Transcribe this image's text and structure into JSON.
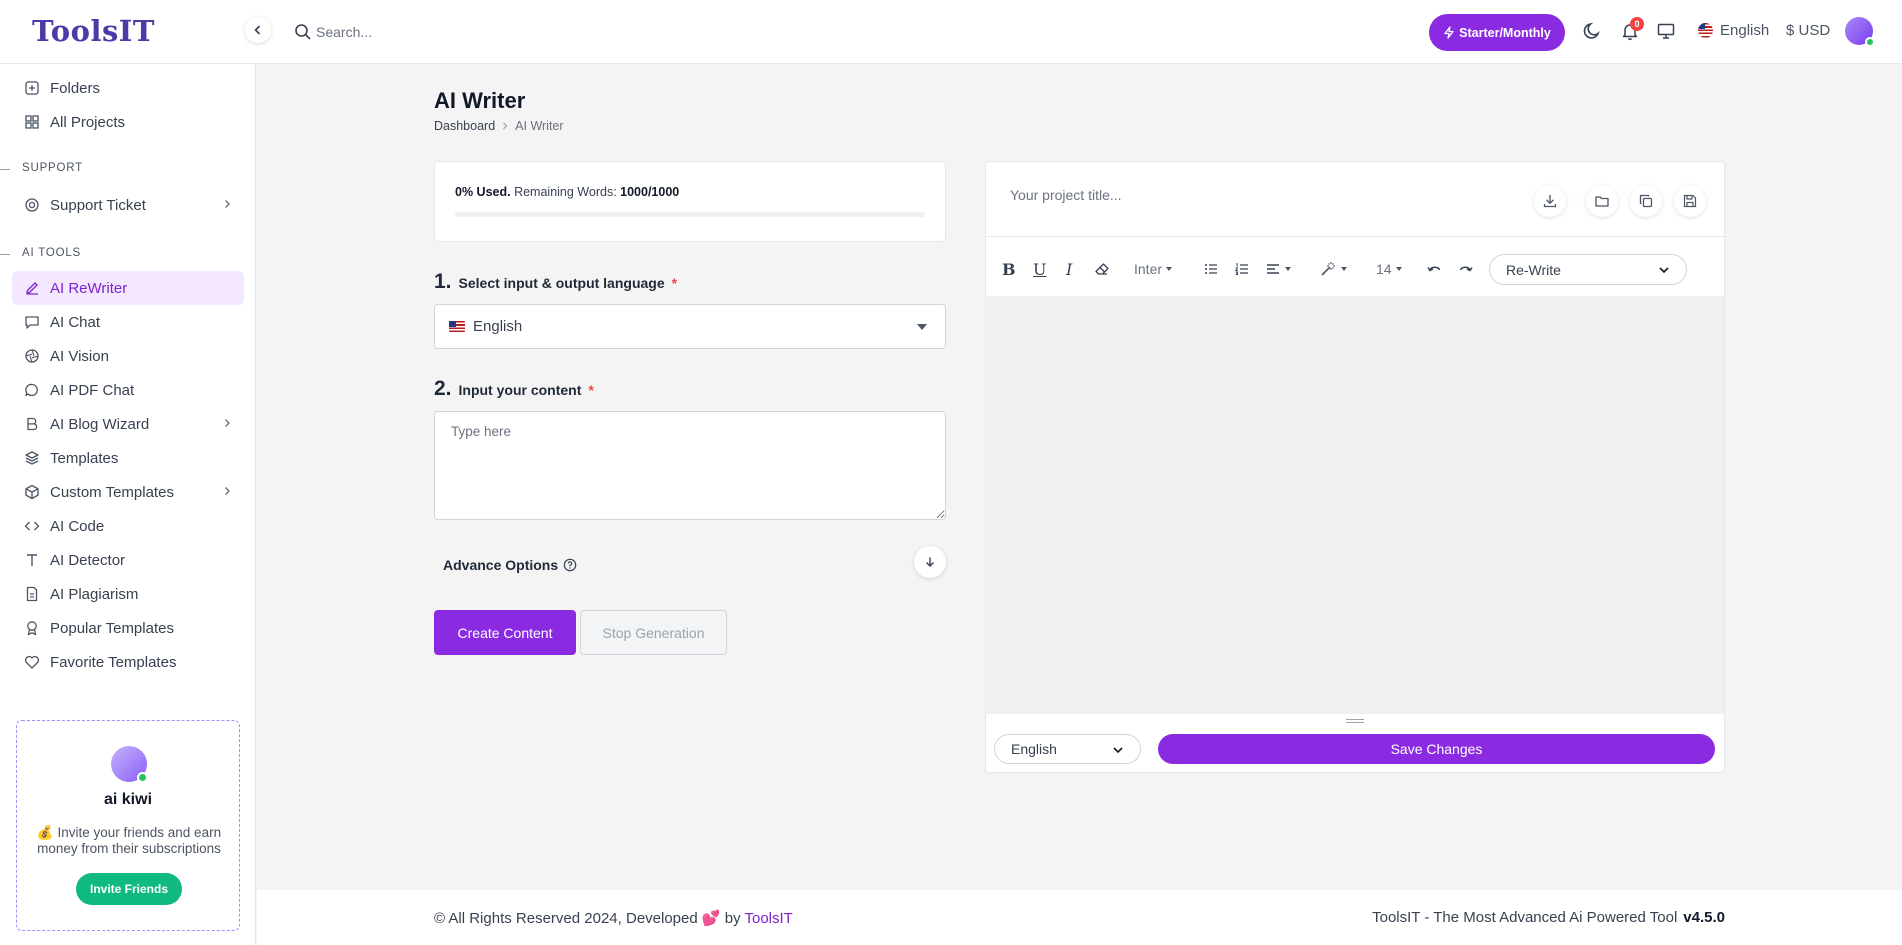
{
  "app": {
    "logo": "ToolsIT"
  },
  "topbar": {
    "search_placeholder": "Search...",
    "plan_label": "Starter/Monthly",
    "notification_count": "0",
    "language": "English",
    "currency": "$ USD"
  },
  "sidebar": {
    "items_top": [
      {
        "label": "Folders",
        "icon": "folder-plus-icon"
      },
      {
        "label": "All Projects",
        "icon": "grid-icon"
      }
    ],
    "support_section": "SUPPORT",
    "support_items": [
      {
        "label": "Support Ticket",
        "icon": "lifebuoy-icon",
        "has_submenu": true
      }
    ],
    "ai_tools_section": "AI TOOLS",
    "ai_tools": [
      {
        "label": "AI ReWriter",
        "icon": "pencil-icon",
        "active": true
      },
      {
        "label": "AI Chat",
        "icon": "chat-icon"
      },
      {
        "label": "AI Vision",
        "icon": "aperture-icon"
      },
      {
        "label": "AI PDF Chat",
        "icon": "message-circle-icon"
      },
      {
        "label": "AI Blog Wizard",
        "icon": "bold-icon",
        "has_submenu": true
      },
      {
        "label": "Templates",
        "icon": "layers-icon"
      },
      {
        "label": "Custom Templates",
        "icon": "cube-icon",
        "has_submenu": true
      },
      {
        "label": "AI Code",
        "icon": "code-icon"
      },
      {
        "label": "AI Detector",
        "icon": "text-icon"
      },
      {
        "label": "AI Plagiarism",
        "icon": "file-icon"
      },
      {
        "label": "Popular Templates",
        "icon": "award-icon"
      },
      {
        "label": "Favorite Templates",
        "icon": "heart-icon"
      }
    ],
    "invite_card": {
      "name": "ai kiwi",
      "text": "💰 Invite your friends and earn money from their subscriptions",
      "button": "Invite Friends"
    }
  },
  "main": {
    "title": "AI Writer",
    "breadcrumb": [
      "Dashboard",
      "AI Writer"
    ],
    "usage": {
      "used_label": "0% Used.",
      "remaining_label": "Remaining Words:",
      "remaining_value": "1000/1000",
      "used_fraction": 0
    },
    "step1": {
      "num": "1.",
      "label": "Select input & output language",
      "required": "*",
      "value": "English"
    },
    "step2": {
      "num": "2.",
      "label": "Input your content",
      "required": "*",
      "placeholder": "Type here"
    },
    "advance_options": "Advance Options",
    "create_button": "Create Content",
    "stop_button": "Stop Generation"
  },
  "editor": {
    "title_placeholder": "Your project title...",
    "font_family": "Inter",
    "font_size": "14",
    "rewrite_option": "Re-Write",
    "language": "English",
    "save_button": "Save Changes"
  },
  "footer": {
    "copyright_prefix": "© All Rights Reserved 2024, Developed",
    "heart": "💕",
    "by": "by",
    "brand": "ToolsIT",
    "tagline": "ToolsIT - The Most Advanced Ai Powered Tool",
    "version": "v4.5.0"
  },
  "colors": {
    "accent": "#8a2be2",
    "invite_button": "#10b981",
    "active_bg": "#f3e8ff"
  }
}
